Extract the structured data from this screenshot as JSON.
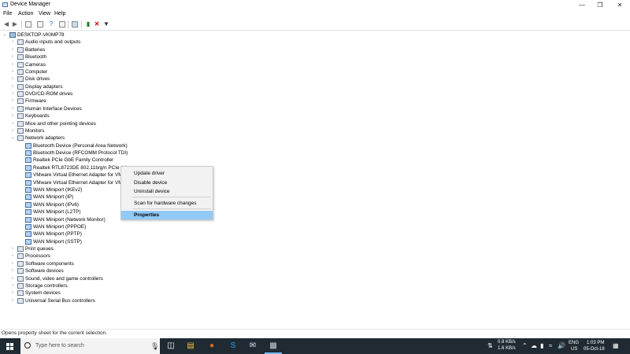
{
  "window": {
    "title": "Device Manager",
    "controls": {
      "minimize": "—",
      "restore": "❐",
      "close": "✕"
    }
  },
  "menu": [
    "File",
    "Action",
    "View",
    "Help"
  ],
  "tree": {
    "root": "DESKTOP-VKIMP78",
    "categories": [
      "Audio inputs and outputs",
      "Batteries",
      "Bluetooth",
      "Cameras",
      "Computer",
      "Disk drives",
      "Display adapters",
      "DVD/CD-ROM drives",
      "Firmware",
      "Human Interface Devices",
      "Keyboards",
      "Mice and other pointing devices",
      "Monitors",
      "Network adapters"
    ],
    "network_adapters": [
      "Bluetooth Device (Personal Area Network)",
      "Bluetooth Device (RFCOMM Protocol TDI)",
      "Realtek PCIe GbE Family Controller",
      "Realtek RTL8723DE 802.11b/g/n PCIe Ada",
      "VMware Virtual Ethernet Adapter for VM",
      "VMware Virtual Ethernet Adapter for VM",
      "WAN Miniport (IKEv2)",
      "WAN Miniport (IP)",
      "WAN Miniport (IPv6)",
      "WAN Miniport (L2TP)",
      "WAN Miniport (Network Monitor)",
      "WAN Miniport (PPPOE)",
      "WAN Miniport (PPTP)",
      "WAN Miniport (SSTP)"
    ],
    "categories_after": [
      "Print queues",
      "Processors",
      "Software components",
      "Software devices",
      "Sound, video and game controllers",
      "Storage controllers",
      "System devices",
      "Universal Serial Bus controllers"
    ]
  },
  "context_menu": {
    "update": "Update driver",
    "disable": "Disable device",
    "uninstall": "Uninstall device",
    "scan": "Scan for hardware changes",
    "properties": "Properties"
  },
  "status": "Opens property sheet for the current selection.",
  "taskbar": {
    "search_placeholder": "Type here to search",
    "upload_speed": "0.8 KB/s",
    "download_speed": "1.6 KB/s",
    "language": "ENG",
    "region": "US",
    "time": "1:03 PM",
    "date": "05-Oct-18"
  }
}
